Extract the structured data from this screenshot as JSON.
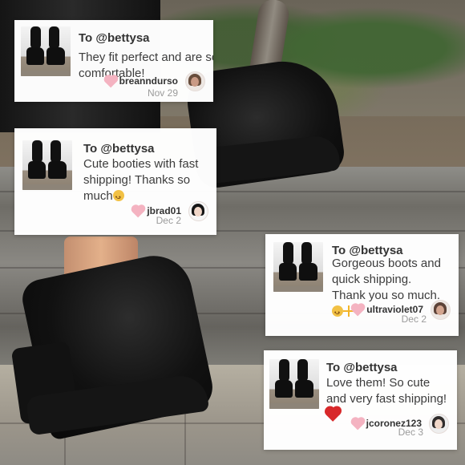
{
  "reviews": [
    {
      "to": "To @bettysa",
      "message": "They fit perfect and are so comfortable!",
      "username": "breanndurso",
      "date": "Nov 29",
      "icons": [
        "heart-icon",
        "avatar-icon"
      ]
    },
    {
      "to": "To @bettysa",
      "message": "Cute booties with fast shipping! Thanks so much",
      "username": "jbrad01",
      "date": "Dec 2",
      "icons": [
        "heart-icon",
        "smile-emoji-icon",
        "avatar-icon"
      ]
    },
    {
      "to": "To @bettysa",
      "message": "Gorgeous boots and quick shipping. Thank you so much.",
      "username": "ultraviolet07",
      "date": "Dec 2",
      "icons": [
        "heart-icon",
        "smile-emoji-icon",
        "sparkle-icon",
        "avatar-icon"
      ]
    },
    {
      "to": "To @bettysa",
      "message": "Love them! So cute and very fast shipping!",
      "username": "jcoronez123",
      "date": "Dec 3",
      "icons": [
        "heart-icon",
        "red-heart-emoji-icon",
        "avatar-icon"
      ]
    }
  ],
  "colors": {
    "heart": "#f4b3c1",
    "text": "#333333",
    "date": "#9b9b9b",
    "emoji_yellow": "#f2c144",
    "emoji_red": "#d8282a"
  }
}
